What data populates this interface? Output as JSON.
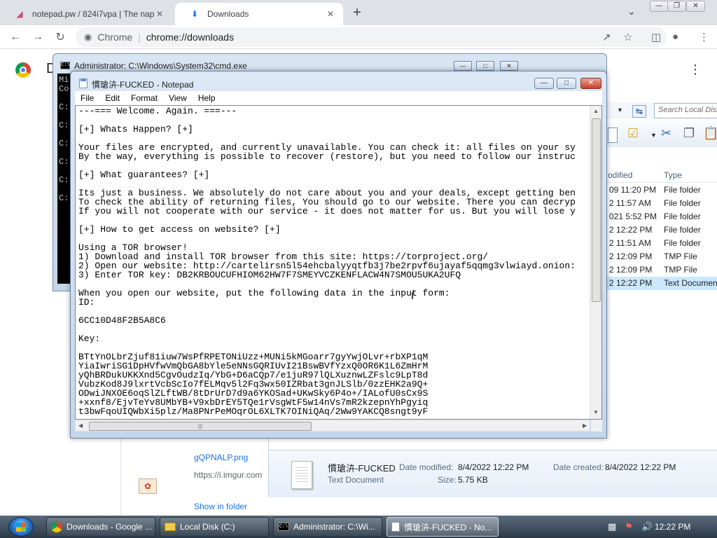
{
  "browser": {
    "tabs": [
      {
        "title": "notepad.pw / 824i7vpa | The nap",
        "active": false
      },
      {
        "title": "Downloads",
        "active": true
      }
    ],
    "omnibox": {
      "badge": "Chrome",
      "url": "chrome://downloads"
    }
  },
  "downloads_page": {
    "title_visible": "D",
    "item": {
      "file_name": "gQPNALP.png",
      "url": "https://i.imgur.com",
      "show_in_folder": "Show in folder"
    }
  },
  "explorer": {
    "search_placeholder": "Search Local Disk",
    "columns": {
      "modified": "odified",
      "type": "Type"
    },
    "rows": [
      {
        "modified": "09 11:20 PM",
        "type": "File folder",
        "selected": false
      },
      {
        "modified": "2 11:57 AM",
        "type": "File folder",
        "selected": false
      },
      {
        "modified": "021 5:52 PM",
        "type": "File folder",
        "selected": false
      },
      {
        "modified": "2 12:22 PM",
        "type": "File folder",
        "selected": false
      },
      {
        "modified": "2 11:51 AM",
        "type": "File folder",
        "selected": false
      },
      {
        "modified": "2 12:09 PM",
        "type": "TMP File",
        "selected": false
      },
      {
        "modified": "2 12:09 PM",
        "type": "TMP File",
        "selected": false
      },
      {
        "modified": "2 12:22 PM",
        "type": "Text Documen",
        "selected": true
      }
    ],
    "details": {
      "name": "慣瑲泋-FUCKED",
      "kind": "Text Document",
      "date_modified_label": "Date modified:",
      "date_modified": "8/4/2022 12:22 PM",
      "size_label": "Size:",
      "size": "5.75 KB",
      "date_created_label": "Date created:",
      "date_created": "8/4/2022 12:22 PM"
    }
  },
  "cmd": {
    "title": "Administrator: C:\\Windows\\System32\\cmd.exe",
    "console_text": "Mi\nCo\n\nC:\n\nC:\n\nC:\n\nC:\n\nC:\n\nC:"
  },
  "notepad": {
    "title": "慣瑲泋-FUCKED - Notepad",
    "menu": [
      "File",
      "Edit",
      "Format",
      "View",
      "Help"
    ],
    "content": "---=== Welcome. Again. ===---\n\n[+] Whats Happen? [+]\n\nYour files are encrypted, and currently unavailable. You can check it: all files on your sy\nBy the way, everything is possible to recover (restore), but you need to follow our instruc\n\n[+] What guarantees? [+]\n\nIts just a business. We absolutely do not care about you and your deals, except getting ben\nTo check the ability of returning files, You should go to our website. There you can decryp\nIf you will not cooperate with our service - it does not matter for us. But you will lose y\n\n[+] How to get access on website? [+]\n\nUsing a TOR browser!\n1) Download and install TOR browser from this site: https://torproject.org/\n2) Open our website: http://cartelirsn5l54ehcbalyyqtfb3j7be2rpvf6ujayaf5qqmg3vlwiayd.onion:\n3) Enter TOR key: DB2KRBOUCUFHIOM62HW7F7SMEYVCZKENFLACW4N7SMOU5UKA2UFQ\n\nWhen you open our website, put the following data in the input form:\nID:\n\n6CC10D48F2B5A8C6\n\nKey:\n\nBTtYnOLbrZjuf81iuw7WsPfRPETONiUzz+MUNi5kMGoarr7gyYwjOLvr+rbXP1qM\nYiaIwriSG1DpHVfwVmQbGA8bYle5eNNsGQRIUvI21BswBVfYzxQ0OR6K1L6ZmHrM\nyQhBRDukUKKXnd5CgvOudzIq/YbG+D6aCQp7/e1juR97lQLXuznwLZFslc9LpT8d\nVubzKod8J9lxrtVcbScIo7fELMqv5l2Fq3wx50IZRbat3gnJLSlb/0zzEHK2a9Q+\nODwiJNXOE6oqSlZLftWB/8tDrUrD7d9a6YKOSad+UKwSky6P4o+/IALofU0sCx9S\n+xxnf8/EjvTeYv8UMbYB+V9xbDrEY5TQe1rVsgWtF5w14nVs7mR2kzepnYhPgyiq\nt3bwFqoUIQWbXi5plz/Ma8PNrPeMOqrOL6XLTK7OINiQAq/2Ww9YAKCQ8sngt9yF"
  },
  "taskbar": {
    "tasks": [
      {
        "label": "Downloads - Google ...",
        "icon": "chrome-icon",
        "active": false
      },
      {
        "label": "Local Disk (C:)",
        "icon": "folder-icon",
        "active": false
      },
      {
        "label": "Administrator: C:\\Wi...",
        "icon": "cmd-icon",
        "active": false
      },
      {
        "label": "慣瑲泋-FUCKED - No...",
        "icon": "notepad-icon",
        "active": true
      }
    ],
    "clock": "12:22 PM"
  }
}
